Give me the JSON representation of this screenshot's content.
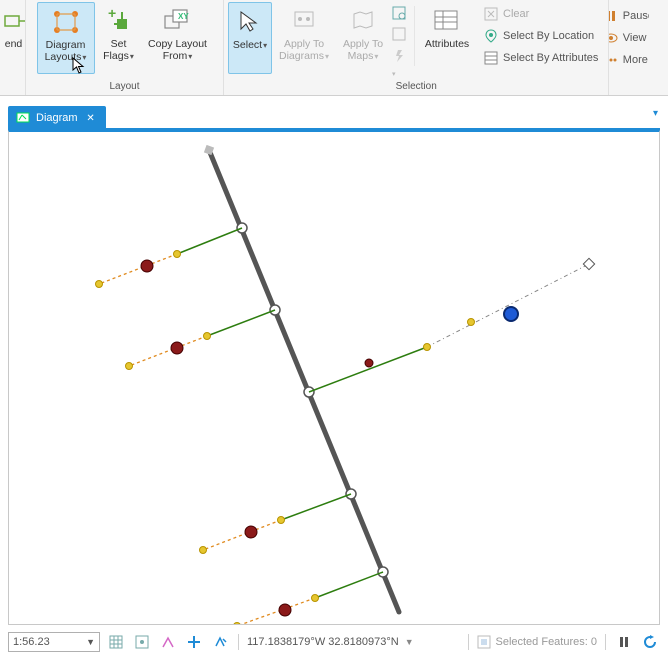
{
  "ribbon": {
    "groups": {
      "layout": {
        "label": "Layout",
        "end_fragment": "end",
        "diagram_layouts": "Diagram Layouts",
        "set_flags": "Set Flags",
        "copy_layout_from": "Copy Layout From"
      },
      "selection": {
        "label": "Selection",
        "select": "Select",
        "apply_to_diagrams": "Apply To Diagrams",
        "apply_to_maps": "Apply To Maps",
        "attributes": "Attributes",
        "clear": "Clear",
        "select_by_location": "Select By Location",
        "select_by_attributes": "Select By Attributes"
      },
      "right": {
        "pause": "Pause",
        "view": "View",
        "more": "More"
      }
    }
  },
  "tab": {
    "title": "Diagram"
  },
  "status": {
    "scale": "1:56.23",
    "coords": "117.1838179°W 32.8180973°N",
    "selected_label": "Selected Features: 0"
  }
}
